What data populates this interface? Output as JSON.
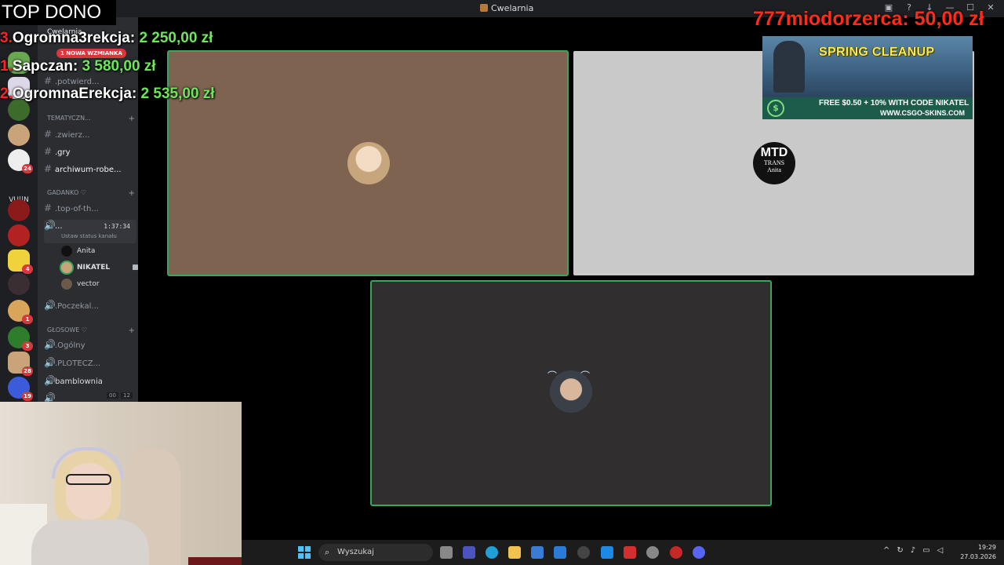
{
  "window": {
    "title": "Cwelarnia"
  },
  "overlay": {
    "top_dono_label": "TOP DONO",
    "leaderboard": [
      {
        "rank": "3.",
        "name": "Ogromna3rekcja",
        "amount": "2 250,00 zł"
      },
      {
        "rank": "1.",
        "name": "Sapczan",
        "amount": "3 580,00 zł"
      },
      {
        "rank": "2.",
        "name": "OgromnaErekcja",
        "amount": "2 535,00 zł"
      }
    ],
    "top_donor": {
      "name": "777miodorzerca",
      "amount": "50,00 zł"
    }
  },
  "ad": {
    "headline": "SPRING CLEANUP",
    "promo": "FREE $0.50 + 10% WITH CODE NIKATEL",
    "url": "WWW.CSGO-SKINS.COM"
  },
  "sidebar": {
    "server_name": "Cwelarnia",
    "new_mention": "1 NOWA WZMIANKA",
    "channels": [
      {
        "name": ".potwierd..."
      },
      {
        "name": ".zwierz..."
      },
      {
        "name": ".gry"
      },
      {
        "name": "archiwum-robe..."
      },
      {
        "name": ".top-of-th..."
      }
    ],
    "categories": {
      "tematyczne": "TEMATYCZN...",
      "gadanko": "GADANKO ♡",
      "glosowe": "GŁOSOWE ♡"
    },
    "active_voice": {
      "name": "...",
      "timer": "1:37:34",
      "status_hint": "Ustaw status kanału"
    },
    "voice_users": [
      {
        "name": "Anita"
      },
      {
        "name": "NIKATEL"
      },
      {
        "name": "vector"
      }
    ],
    "voice_channels": [
      {
        "name": ".Poczekal..."
      },
      {
        "name": ".Ogólny"
      },
      {
        "name": ".PLOTECZ..."
      },
      {
        "name": "bamblownia"
      }
    ],
    "bottom_counts": [
      "00",
      "12"
    ],
    "server_rail": {
      "text_server": "VU||N",
      "badges": [
        "24",
        "4",
        "1",
        "3",
        "28",
        "19"
      ]
    }
  },
  "video": {
    "mtd_logo": {
      "line1": "MTD",
      "line2": "TRANS",
      "line3": "Anita"
    }
  },
  "taskbar": {
    "search_placeholder": "Wyszukaj",
    "time": "19:29",
    "date": "27.03.2026"
  },
  "colors": {
    "speaking": "#3ba55d",
    "tile_brown": "#7e6450",
    "tile_grey": "#c9c9c9",
    "tile_dark": "#302e2e",
    "discord_bg": "#2b2d31",
    "leaderboard_amount": "#6ee65a",
    "donor_red": "#ff2a1a"
  }
}
